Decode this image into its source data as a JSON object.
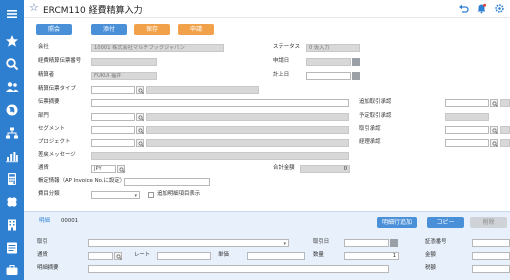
{
  "header": {
    "title": "ERCM110 経費精算入力"
  },
  "rail": {
    "icons": [
      "star-icon",
      "search-icon",
      "people-icon",
      "globe-icon",
      "org-icon",
      "chart-icon",
      "calculator-icon",
      "clover-icon",
      "building-icon",
      "document-icon",
      "briefcase-icon"
    ]
  },
  "toolbar": {
    "view_label": "照会",
    "add_label": "添付",
    "save_label": "保存",
    "apply_label": "申請"
  },
  "form": {
    "company_label": "会社",
    "company_value": "10001 株式会社マルチブックジャパン",
    "slip_no_label": "経費精算伝票番号",
    "applicant_label": "精算者",
    "applicant_value": "FUKUI 福井",
    "slip_type_label": "精算伝票タイプ",
    "status_label": "ステータス",
    "status_value": "0 仮入力",
    "apply_date_label": "申請日",
    "post_date_label": "計上日",
    "summary_label": "伝票摘要",
    "dept_label": "部門",
    "segment_label": "セグメント",
    "project_label": "プロジェクト",
    "reject_msg_label": "差戻メッセージ",
    "currency_label": "通貨",
    "currency_value": "JPY",
    "total_label": "合計金額",
    "total_value": "0",
    "invoice_label": "帳定情報（AP Invoice No.に設定）",
    "cost_class_label": "費目分類",
    "add_detail_label": "追加明細項目表示",
    "add_approver_label": "追加取引承認",
    "planned_approver_label": "予定取引承認",
    "txn_approver_label": "取引承認",
    "acct_approver_label": "経理承認"
  },
  "detail": {
    "tab_label": "明細",
    "tab_no": "00001",
    "add_row_label": "明細行追加",
    "copy_label": "コピー",
    "delete_label": "削除",
    "txn_label": "取引",
    "txn_date_label": "取引日",
    "voucher_label": "証憑番号",
    "currency_label": "通貨",
    "rate_label": "レート",
    "unit_price_label": "単価",
    "qty_label": "数量",
    "qty_value": "1",
    "amount_label": "金額",
    "desc_label": "明細摘要",
    "tax_label": "税額"
  }
}
